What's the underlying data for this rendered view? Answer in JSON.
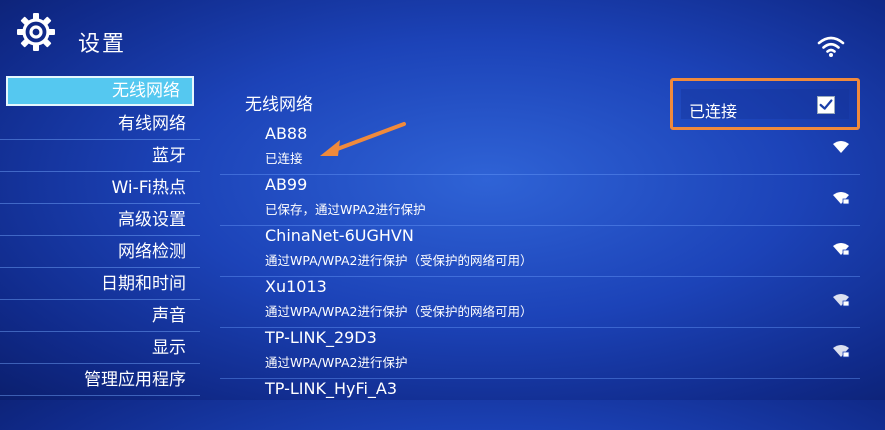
{
  "header": {
    "title": "设置",
    "gear_icon": "gear-icon",
    "wifi_icon": "wifi-icon"
  },
  "sidebar": {
    "items": [
      {
        "label": "无线网络",
        "selected": true
      },
      {
        "label": "有线网络"
      },
      {
        "label": "蓝牙"
      },
      {
        "label": "Wi-Fi热点"
      },
      {
        "label": "高级设置"
      },
      {
        "label": "网络检测"
      },
      {
        "label": "日期和时间"
      },
      {
        "label": "声音"
      },
      {
        "label": "显示"
      },
      {
        "label": "管理应用程序"
      }
    ]
  },
  "main": {
    "section_title": "无线网络",
    "connected": {
      "label": "已连接",
      "checked": true,
      "highlight_color": "#f08a3c"
    },
    "networks": [
      {
        "name": "AB88",
        "status": "已连接"
      },
      {
        "name": "AB99",
        "status": "已保存，通过WPA2进行保护"
      },
      {
        "name": "ChinaNet-6UGHVN",
        "status": "通过WPA/WPA2进行保护（受保护的网络可用）"
      },
      {
        "name": "Xu1013",
        "status": "通过WPA/WPA2进行保护（受保护的网络可用）"
      },
      {
        "name": "TP-LINK_29D3",
        "status": "通过WPA/WPA2进行保护"
      },
      {
        "name": "TP-LINK_HyFi_A3",
        "status": ""
      }
    ]
  },
  "colors": {
    "accent": "#55c8f0",
    "annotation": "#f08a3c"
  }
}
